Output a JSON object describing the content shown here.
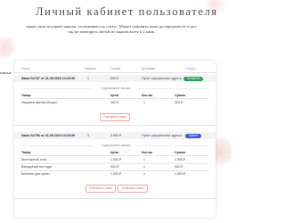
{
  "header": {
    "title": "Личный кабинет пользователя",
    "subtitle_line1": "видит свою историю заказов, отслеживает их статус. Может отменить заказ до передачи его в дос",
    "subtitle_line2": "так же повторить любой из заказов всего в 2 клик."
  },
  "side_text": {
    "line1": "омные",
    "line2": ""
  },
  "table": {
    "columns": [
      "Заказ",
      "Товаров",
      "Сумма",
      "Доставка",
      "Статус"
    ]
  },
  "orders": [
    {
      "title": "Заказ №787 от 21.05.2020 14:23:59",
      "items_count": "1",
      "total": "500 ₽",
      "delivery": "Пункт оформления адреса",
      "status": "Оплачено",
      "status_color": "#2f9e5a",
      "contents_label": "Содержимое заказа",
      "item_columns": [
        "Товар",
        "Цена",
        "Кол-во",
        "Сумма"
      ],
      "items": [
        {
          "name": "Нюдовка цветов Мощне",
          "price": "300 ₽",
          "qty": "1",
          "sum": "300 ₽"
        }
      ],
      "repeat_button": "Повторить заказ",
      "cancel_button": ""
    },
    {
      "title": "Заказ №786 от 21.05.2020 14:23:59",
      "items_count": "3",
      "total": "3 500 ₽",
      "delivery": "Пункт оформления адреса",
      "status": "Принят",
      "status_color": "#3b5bd6",
      "contents_label": "Содержимое заказа",
      "item_columns": [
        "Товар",
        "Цена",
        "Кол-во",
        "Сумма"
      ],
      "items": [
        {
          "name": "Монтажный лось",
          "price": "1 500 ₽",
          "qty": "1",
          "sum": "1 500 ₽"
        },
        {
          "name": "Вандорный все зуда",
          "price": "500 ₽",
          "qty": "1",
          "sum": "500 ₽"
        },
        {
          "name": "Весенни для кухни",
          "price": "1 500 ₽",
          "qty": "1",
          "sum": "1 500 ₽"
        }
      ],
      "repeat_button": "Повторить заказ",
      "cancel_button": "Отменить заказ"
    }
  ],
  "colors": {
    "accent": "#d06a6a",
    "paid": "#2f9e5a",
    "accepted": "#3b5bd6",
    "row_bg": "#f3f3f6"
  }
}
